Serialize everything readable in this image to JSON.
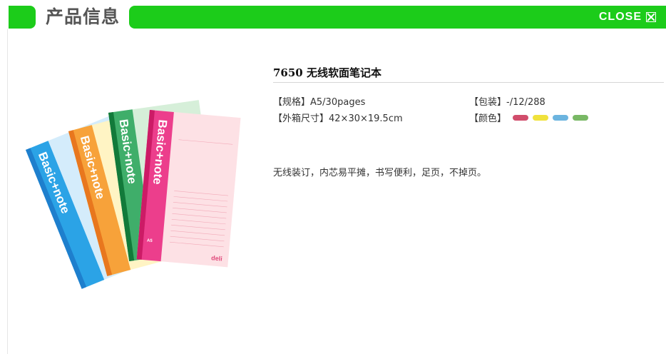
{
  "header": {
    "title": "产品信息",
    "close_label": "CLOSE",
    "accent_color": "#1ccc1a"
  },
  "product": {
    "title": "7650 无线软面笔记本",
    "specs": {
      "spec_label": "【规格】",
      "spec_value": "A5/30pages",
      "carton_label": "【外箱尺寸】",
      "carton_value": "42×30×19.5cm",
      "packing_label": "【包装】",
      "packing_value": "-/12/288",
      "color_label": "【颜色】"
    },
    "colors": [
      "#d14d6c",
      "#f0e23c",
      "#6cb4df",
      "#79b865"
    ],
    "description": "无线装订，内芯易平摊，书写便利，足页，不掉页。"
  },
  "image": {
    "cover_text": "Basic+note",
    "brand": "deli",
    "size_mark": "A5",
    "notebooks": [
      {
        "spine": "#1e7fcd",
        "cover": "#2ba3e6",
        "page": "#d4ecfb"
      },
      {
        "spine": "#e8771e",
        "cover": "#f7a23a",
        "page": "#fff4c4"
      },
      {
        "spine": "#127a3a",
        "cover": "#3fae6a",
        "page": "#d6efd9"
      },
      {
        "spine": "#cc1b66",
        "cover": "#ec3e8c",
        "page": "#fde1e5"
      }
    ]
  }
}
